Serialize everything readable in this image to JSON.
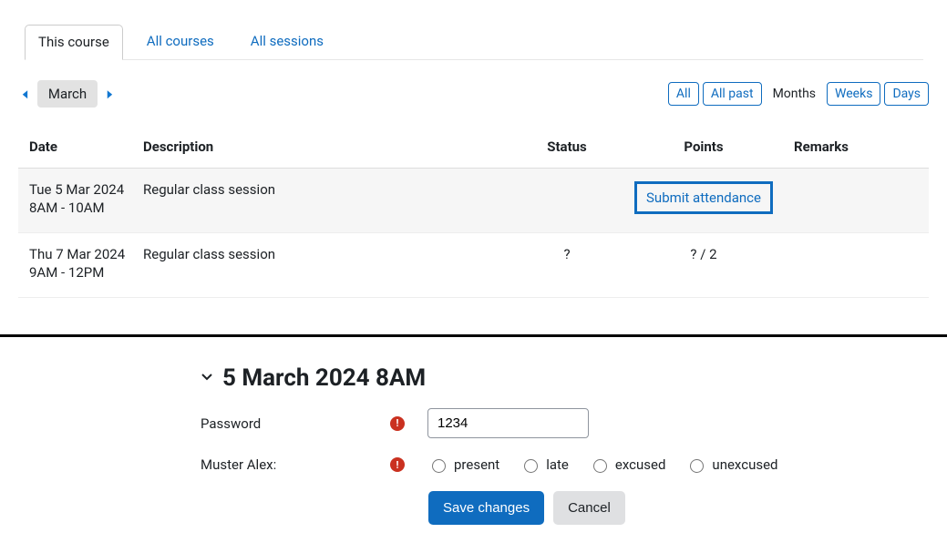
{
  "tabs": {
    "this_course": "This course",
    "all_courses": "All courses",
    "all_sessions": "All sessions"
  },
  "month_nav": {
    "current": "March"
  },
  "filters": {
    "all": "All",
    "all_past": "All past",
    "months": "Months",
    "weeks": "Weeks",
    "days": "Days"
  },
  "table": {
    "headers": {
      "date": "Date",
      "description": "Description",
      "status": "Status",
      "points": "Points",
      "remarks": "Remarks"
    },
    "rows": [
      {
        "date_line1": "Tue 5 Mar 2024",
        "date_line2": "8AM - 10AM",
        "description": "Regular class session",
        "status": "",
        "points_cell": "Submit attendance",
        "points_is_button": true,
        "remarks": ""
      },
      {
        "date_line1": "Thu 7 Mar 2024",
        "date_line2": "9AM - 12PM",
        "description": "Regular class session",
        "status": "?",
        "points_cell": "? / 2",
        "points_is_button": false,
        "remarks": ""
      }
    ]
  },
  "form": {
    "title": "5 March 2024 8AM",
    "password_label": "Password",
    "password_value": "1234",
    "user_label": "Muster Alex:",
    "options": {
      "present": "present",
      "late": "late",
      "excused": "excused",
      "unexcused": "unexcused"
    },
    "save": "Save changes",
    "cancel": "Cancel"
  }
}
